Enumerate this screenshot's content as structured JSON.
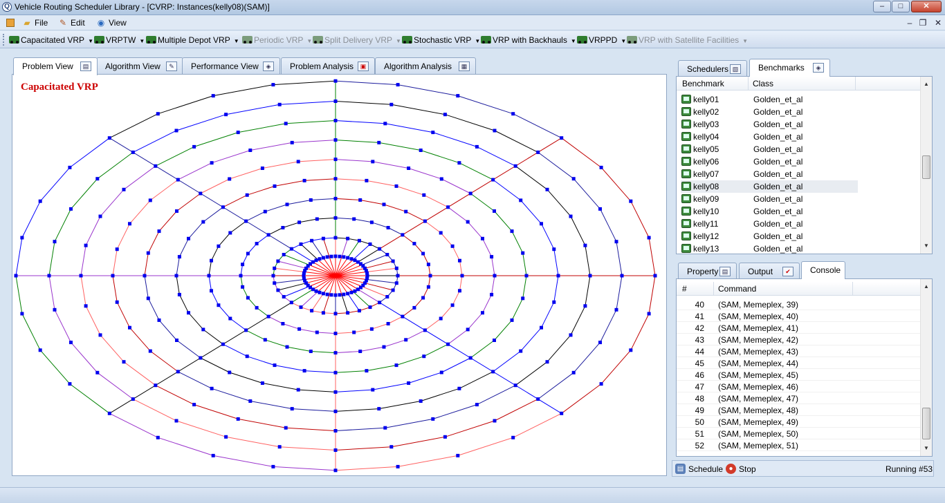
{
  "window": {
    "title": "Vehicle Routing Scheduler Library - [CVRP: Instances(kelly08)(SAM)]",
    "minimize": "–",
    "maximize": "□",
    "close": "✕"
  },
  "menu": {
    "items": [
      {
        "label": "File",
        "icon": "folder-icon"
      },
      {
        "label": "Edit",
        "icon": "edit-icon"
      },
      {
        "label": "View",
        "icon": "view-icon"
      }
    ],
    "mdi_minimize": "–",
    "mdi_restore": "❐",
    "mdi_close": "✕"
  },
  "toolbar": {
    "buttons": [
      {
        "label": "Capacitated VRP",
        "enabled": true
      },
      {
        "label": "VRPTW",
        "enabled": true
      },
      {
        "label": "Multiple Depot VRP",
        "enabled": true
      },
      {
        "label": "Periodic VRP",
        "enabled": false
      },
      {
        "label": "Split Delivery VRP",
        "enabled": false
      },
      {
        "label": "Stochastic VRP",
        "enabled": true
      },
      {
        "label": "VRP with Backhauls",
        "enabled": true
      },
      {
        "label": "VRPPD",
        "enabled": true
      },
      {
        "label": "VRP with Satellite Facilities",
        "enabled": false
      }
    ],
    "dropdown_glyph": "▼"
  },
  "left_tabs": [
    {
      "label": "Problem View",
      "active": true
    },
    {
      "label": "Algorithm View",
      "active": false
    },
    {
      "label": "Performance View",
      "active": false
    },
    {
      "label": "Problem Analysis",
      "active": false
    },
    {
      "label": "Algorithm Analysis",
      "active": false
    }
  ],
  "problem_view": {
    "title": "Capacitated VRP",
    "depot_color": "#ff0000",
    "node_color": "#0000ee",
    "route_colors": [
      "#000000",
      "#1a1a9c",
      "#c00000",
      "#ff6060",
      "#9933cc",
      "#008000",
      "#0000ff"
    ]
  },
  "right_top_tabs": [
    {
      "label": "Schedulers",
      "active": false
    },
    {
      "label": "Benchmarks",
      "active": true
    }
  ],
  "benchmarks": {
    "columns": [
      "Benchmark",
      "Class"
    ],
    "selected": "kelly08",
    "rows": [
      {
        "name": "kelly01",
        "class": "Golden_et_al"
      },
      {
        "name": "kelly02",
        "class": "Golden_et_al"
      },
      {
        "name": "kelly03",
        "class": "Golden_et_al"
      },
      {
        "name": "kelly04",
        "class": "Golden_et_al"
      },
      {
        "name": "kelly05",
        "class": "Golden_et_al"
      },
      {
        "name": "kelly06",
        "class": "Golden_et_al"
      },
      {
        "name": "kelly07",
        "class": "Golden_et_al"
      },
      {
        "name": "kelly08",
        "class": "Golden_et_al"
      },
      {
        "name": "kelly09",
        "class": "Golden_et_al"
      },
      {
        "name": "kelly10",
        "class": "Golden_et_al"
      },
      {
        "name": "kelly11",
        "class": "Golden_et_al"
      },
      {
        "name": "kelly12",
        "class": "Golden_et_al"
      },
      {
        "name": "kelly13",
        "class": "Golden_et_al"
      }
    ]
  },
  "right_bottom_tabs": [
    {
      "label": "Property",
      "active": false
    },
    {
      "label": "Output",
      "active": false
    },
    {
      "label": "Console",
      "active": true
    }
  ],
  "console": {
    "columns": [
      "#",
      "Command"
    ],
    "rows": [
      {
        "n": "40",
        "cmd": "(SAM, Memeplex, 39)"
      },
      {
        "n": "41",
        "cmd": "(SAM, Memeplex, 40)"
      },
      {
        "n": "42",
        "cmd": "(SAM, Memeplex, 41)"
      },
      {
        "n": "43",
        "cmd": "(SAM, Memeplex, 42)"
      },
      {
        "n": "44",
        "cmd": "(SAM, Memeplex, 43)"
      },
      {
        "n": "45",
        "cmd": "(SAM, Memeplex, 44)"
      },
      {
        "n": "46",
        "cmd": "(SAM, Memeplex, 45)"
      },
      {
        "n": "47",
        "cmd": "(SAM, Memeplex, 46)"
      },
      {
        "n": "48",
        "cmd": "(SAM, Memeplex, 47)"
      },
      {
        "n": "49",
        "cmd": "(SAM, Memeplex, 48)"
      },
      {
        "n": "50",
        "cmd": "(SAM, Memeplex, 49)"
      },
      {
        "n": "51",
        "cmd": "(SAM, Memeplex, 50)"
      },
      {
        "n": "52",
        "cmd": "(SAM, Memeplex, 51)"
      }
    ]
  },
  "bottom_bar": {
    "schedule": "Schedule",
    "stop": "Stop",
    "status": "Running #53"
  }
}
